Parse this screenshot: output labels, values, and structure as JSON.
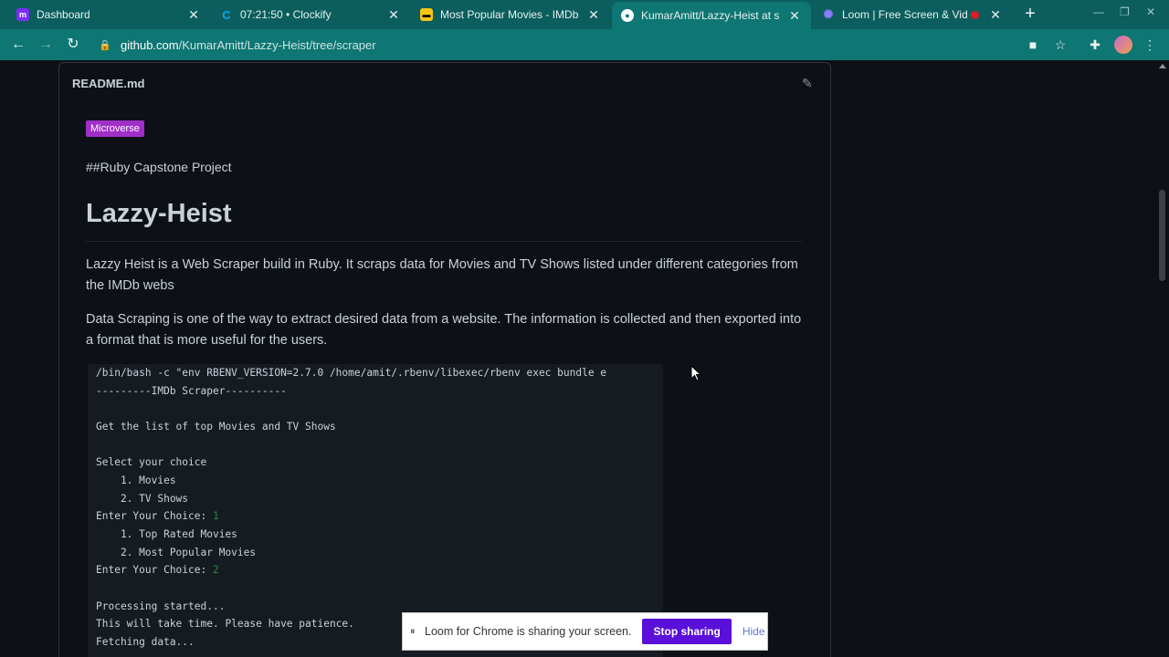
{
  "browser": {
    "tabs": [
      {
        "title": "Dashboard",
        "favicon": "microverse-icon",
        "favicon_color": "#7b2ff7"
      },
      {
        "title": "07:21:50 • Clockify",
        "favicon": "clockify-icon",
        "favicon_color": "#03a9f4"
      },
      {
        "title": "Most Popular Movies - IMDb",
        "favicon": "imdb-icon",
        "favicon_color": "#f5c518"
      },
      {
        "title": "KumarAmitt/Lazzy-Heist at s",
        "favicon": "github-icon",
        "favicon_color": "#ffffff",
        "active": true
      },
      {
        "title": "Loom | Free Screen & Vid",
        "favicon": "loom-icon",
        "favicon_color": "#625df5",
        "recording": true
      }
    ],
    "address": {
      "host": "github.com",
      "path": "/KumarAmitt/Lazzy-Heist/tree/scraper"
    }
  },
  "readme": {
    "filename": "README.md",
    "badge": "Microverse",
    "subtitle": "##Ruby Capstone Project",
    "heading": "Lazzy-Heist",
    "para1": "Lazzy Heist is a Web Scraper build in Ruby. It scraps data for Movies and TV Shows listed under different categories from the IMDb webs",
    "para2": "Data Scraping is one of the way to extract desired data from a website. The information is collected and then exported into a format that is more useful for the users.",
    "code": {
      "l1": "/bin/bash -c \"env RBENV_VERSION=2.7.0 /home/amit/.rbenv/libexec/rbenv exec bundle e",
      "l2": "---------IMDb Scraper----------",
      "l3": "Get the list of top Movies and TV Shows",
      "l4": "Select your choice",
      "l5": "    1. Movies",
      "l6": "    2. TV Shows",
      "l7": "Enter Your Choice: ",
      "l7v": "1",
      "l8": "    1. Top Rated Movies",
      "l9": "    2. Most Popular Movies",
      "l10": "Enter Your Choice: ",
      "l10v": "2",
      "l11": "Processing started...",
      "l12": "This will take time. Please have patience.",
      "l13": "Fetching data..."
    }
  },
  "loom_bar": {
    "message": "Loom for Chrome is sharing your screen.",
    "stop": "Stop sharing",
    "hide": "Hide"
  }
}
